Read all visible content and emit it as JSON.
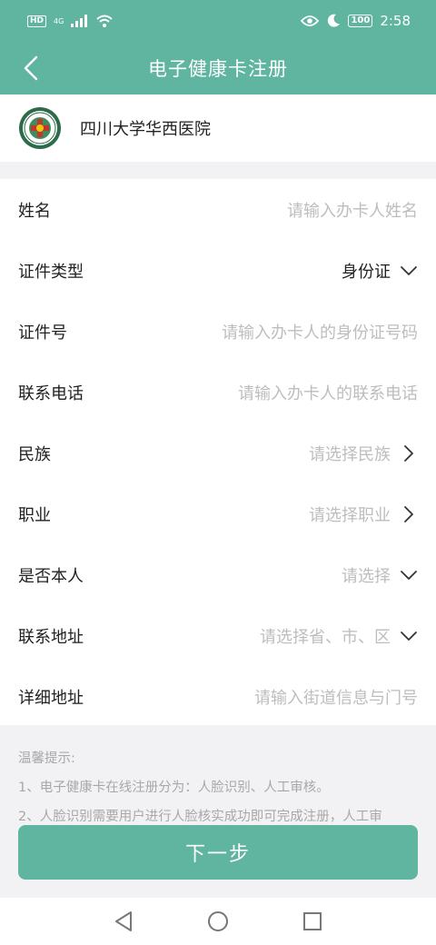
{
  "status_bar": {
    "hd_label": "HD",
    "network_label": "4G",
    "battery": "100",
    "time": "2:58",
    "icons": [
      "signal-icon",
      "wifi-icon",
      "eye-icon",
      "moon-icon"
    ]
  },
  "nav": {
    "title": "电子健康卡注册",
    "back_icon": "chevron-left-icon"
  },
  "hospital": {
    "name": "四川大学华西医院",
    "logo_icon": "hospital-logo"
  },
  "form": {
    "rows": [
      {
        "label": "姓名",
        "placeholder": "请输入办卡人姓名",
        "icon": ""
      },
      {
        "label": "证件类型",
        "value": "身份证",
        "icon": "chevron-down-icon"
      },
      {
        "label": "证件号",
        "placeholder": "请输入办卡人的身份证号码",
        "icon": ""
      },
      {
        "label": "联系电话",
        "placeholder": "请输入办卡人的联系电话",
        "icon": ""
      },
      {
        "label": "民族",
        "placeholder": "请选择民族",
        "icon": "chevron-right-icon"
      },
      {
        "label": "职业",
        "placeholder": "请选择职业",
        "icon": "chevron-right-icon"
      },
      {
        "label": "是否本人",
        "placeholder": "请选择",
        "icon": "chevron-down-icon"
      },
      {
        "label": "联系地址",
        "placeholder": "请选择省、市、区",
        "icon": "chevron-down-icon"
      },
      {
        "label": "详细地址",
        "placeholder": "请输入街道信息与门号",
        "icon": ""
      }
    ]
  },
  "tips": {
    "title": "温馨提示:",
    "lines": [
      "1、电子健康卡在线注册分为：人脸识别、人工审核。",
      "2、人脸识别需要用户进行人脸核实成功即可完成注册，人工审"
    ]
  },
  "next_button": {
    "label": "下一步"
  },
  "system_nav": {
    "icons": [
      "back-triangle-icon",
      "home-circle-icon",
      "recents-square-icon"
    ]
  },
  "colors": {
    "accent": "#5fb5a0",
    "placeholder": "#bdbdbd",
    "background": "#f2f2f4"
  }
}
